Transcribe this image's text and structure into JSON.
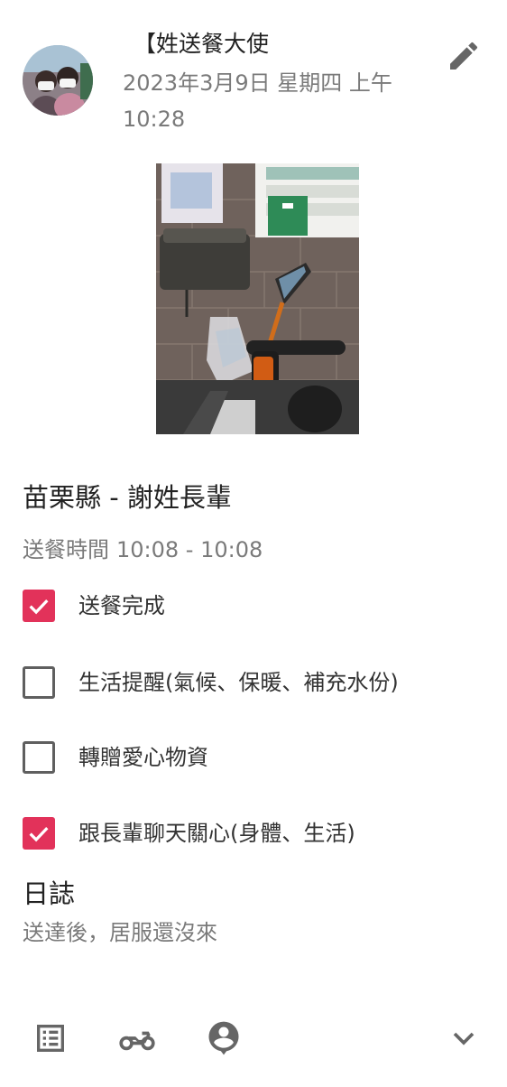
{
  "header": {
    "author": "【姓送餐大使",
    "timestamp": "2023年3月9日 星期四 上午10:28"
  },
  "record": {
    "place": "苗栗縣 - 謝姓長輩",
    "time_label": "送餐時間",
    "time_range": "10:08 - 10:08"
  },
  "tasks": [
    {
      "label": "送餐完成",
      "checked": true
    },
    {
      "label": "生活提醒(氣候、保暖、補充水份)",
      "checked": false
    },
    {
      "label": "轉贈愛心物資",
      "checked": false
    },
    {
      "label": "跟長輩聊天關心(身體、生活)",
      "checked": true
    }
  ],
  "log": {
    "title": "日誌",
    "body": "送達後，居服還沒來"
  },
  "icons": {
    "edit": "pencil-icon",
    "list": "list-icon",
    "vehicle": "motorcycle-icon",
    "user": "person-pin-icon",
    "expand": "chevron-down-icon"
  },
  "colors": {
    "checkbox_checked": "#e2325a",
    "icon_gray": "#666666"
  }
}
